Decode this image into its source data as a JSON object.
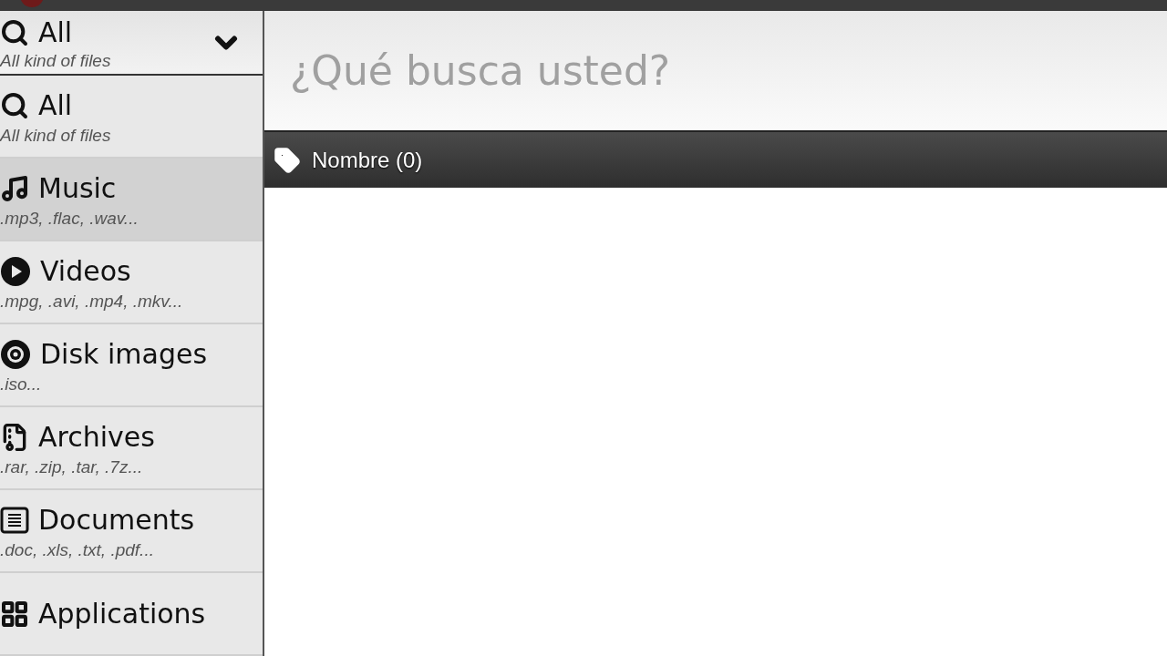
{
  "filter_dropdown": {
    "title": "All",
    "subtitle": "All kind of files"
  },
  "categories": [
    {
      "title": "All",
      "subtitle": "All kind of files",
      "selected": false
    },
    {
      "title": "Music",
      "subtitle": ".mp3, .flac, .wav...",
      "selected": true
    },
    {
      "title": "Videos",
      "subtitle": ".mpg, .avi, .mp4, .mkv...",
      "selected": false
    },
    {
      "title": "Disk images",
      "subtitle": ".iso...",
      "selected": false
    },
    {
      "title": "Archives",
      "subtitle": ".rar, .zip, .tar, .7z...",
      "selected": false
    },
    {
      "title": "Documents",
      "subtitle": ".doc, .xls, .txt, .pdf...",
      "selected": false
    },
    {
      "title": "Applications",
      "selected": false
    }
  ],
  "search": {
    "placeholder": "¿Qué busca usted?"
  },
  "results_header": {
    "label": "Nombre (0)"
  }
}
